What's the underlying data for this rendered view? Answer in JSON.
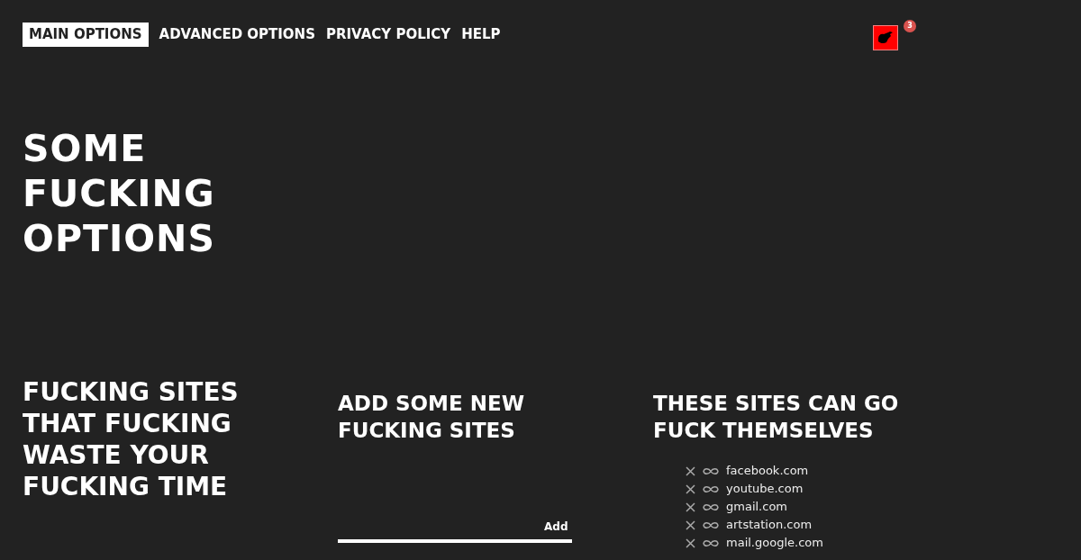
{
  "nav": {
    "tabs": [
      {
        "label": "MAIN OPTIONS",
        "selected": true
      },
      {
        "label": "ADVANCED OPTIONS",
        "selected": false
      },
      {
        "label": "PRIVACY POLICY",
        "selected": false
      },
      {
        "label": "HELP",
        "selected": false
      }
    ]
  },
  "extension": {
    "badge": "3"
  },
  "title": "SOME FUCKING OPTIONS",
  "intro": {
    "heading": "FUCKING SITES THAT FUCKING WASTE YOUR FUCKING TIME"
  },
  "add_section": {
    "heading": "ADD SOME NEW FUCKING SITES",
    "button": "Add"
  },
  "blocked_section": {
    "heading": "THESE SITES CAN GO FUCK THEMSELVES",
    "sites": [
      {
        "domain": "facebook.com"
      },
      {
        "domain": "youtube.com"
      },
      {
        "domain": "gmail.com"
      },
      {
        "domain": "artstation.com"
      },
      {
        "domain": "mail.google.com"
      }
    ]
  }
}
